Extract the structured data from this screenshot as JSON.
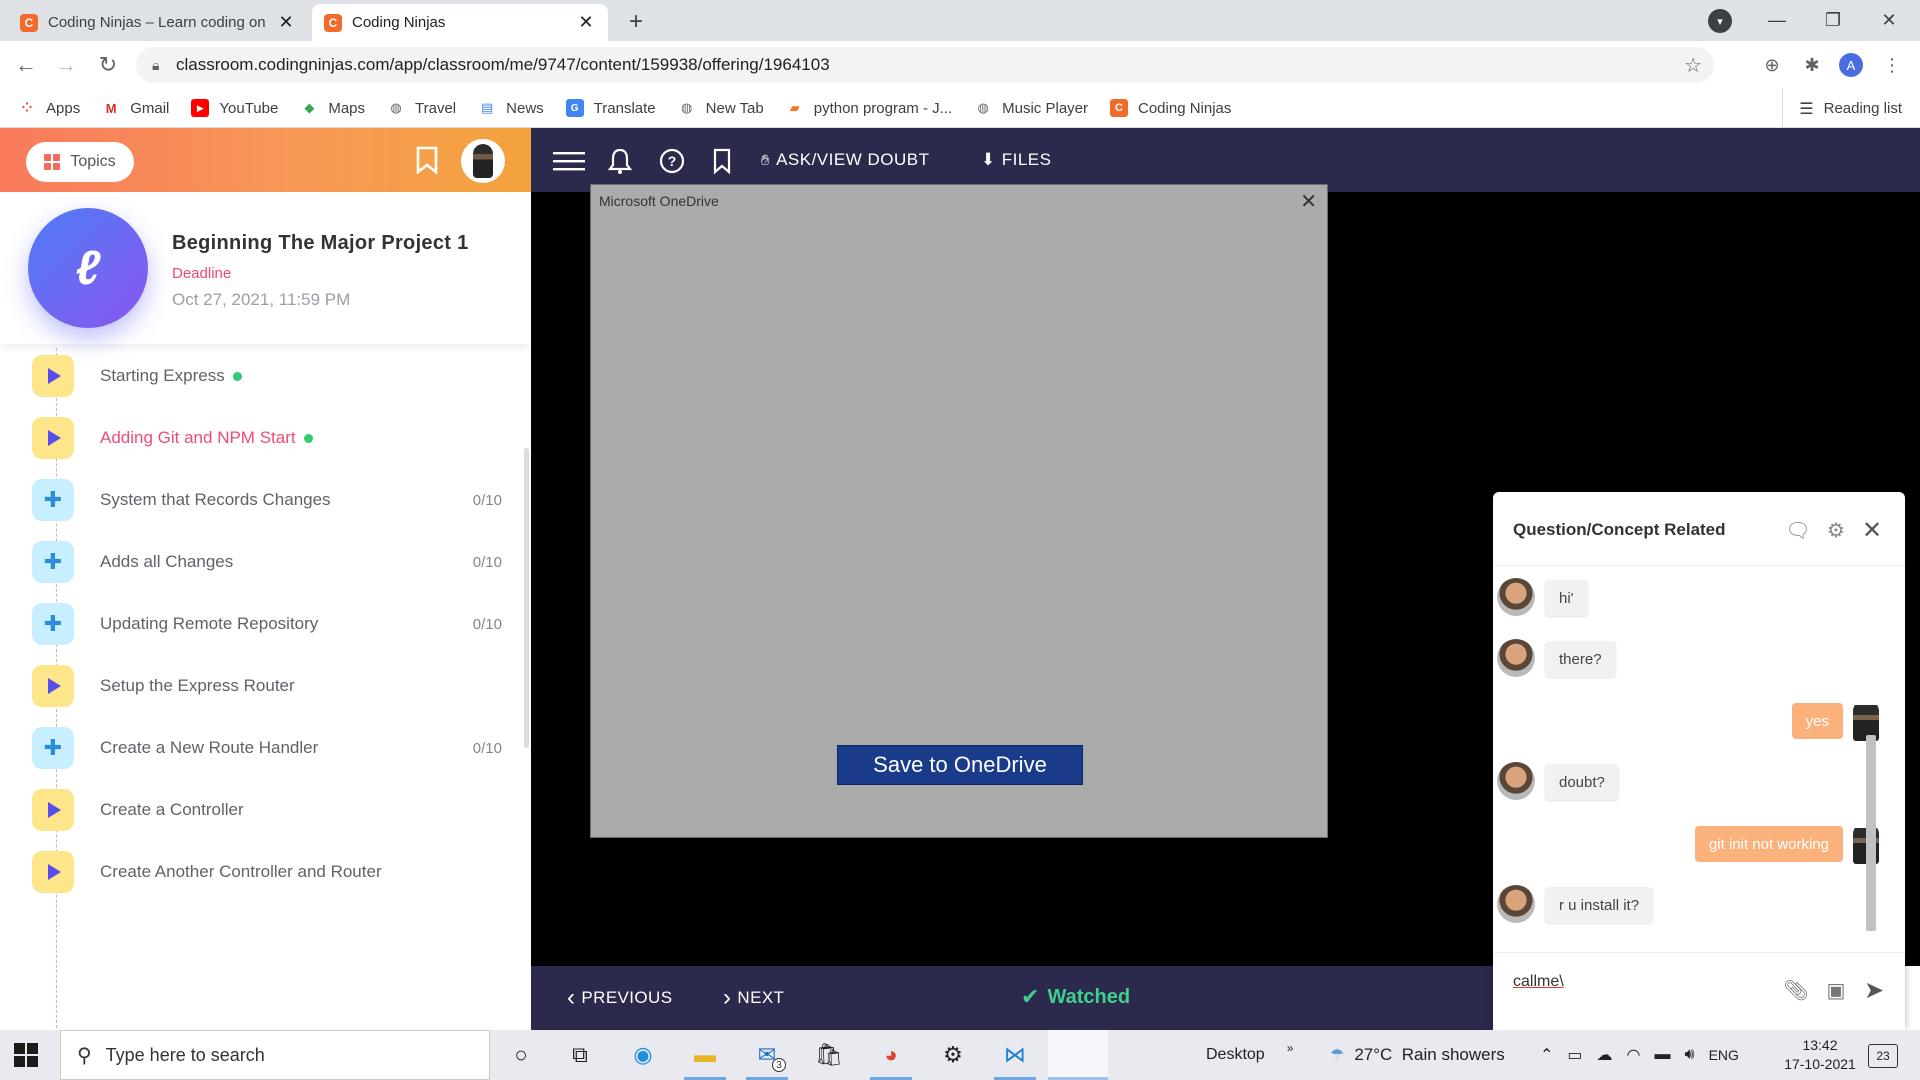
{
  "browser": {
    "tabs": [
      {
        "title": "Coding Ninjas – Learn coding on",
        "active": false
      },
      {
        "title": "Coding Ninjas",
        "active": true
      }
    ],
    "url": "classroom.codingninjas.com/app/classroom/me/9747/content/159938/offering/1964103",
    "profile_initial": "A",
    "bookmarks": [
      {
        "label": "Apps",
        "icon": "apps-grid-icon"
      },
      {
        "label": "Gmail",
        "icon": "gmail-icon"
      },
      {
        "label": "YouTube",
        "icon": "youtube-icon"
      },
      {
        "label": "Maps",
        "icon": "maps-icon"
      },
      {
        "label": "Travel",
        "icon": "globe-icon"
      },
      {
        "label": "News",
        "icon": "news-icon"
      },
      {
        "label": "Translate",
        "icon": "translate-icon"
      },
      {
        "label": "New Tab",
        "icon": "globe-icon"
      },
      {
        "label": "python program - J...",
        "icon": "notebook-icon"
      },
      {
        "label": "Music Player",
        "icon": "globe-icon"
      },
      {
        "label": "Coding Ninjas",
        "icon": "coding-ninjas-icon"
      }
    ],
    "reading_list": "Reading list"
  },
  "left_panel": {
    "topics_label": "Topics",
    "course_title": "Beginning The Major Project 1",
    "deadline_label": "Deadline",
    "deadline_date": "Oct 27, 2021, 11:59 PM",
    "items": [
      {
        "label": "Starting Express",
        "type": "video",
        "done": true,
        "score": "",
        "active": false
      },
      {
        "label": "Adding Git and NPM Start",
        "type": "video",
        "done": true,
        "score": "",
        "active": true
      },
      {
        "label": "System that Records Changes",
        "type": "problem",
        "done": false,
        "score": "0/10",
        "active": false
      },
      {
        "label": "Adds all Changes",
        "type": "problem",
        "done": false,
        "score": "0/10",
        "active": false
      },
      {
        "label": "Updating Remote Repository",
        "type": "problem",
        "done": false,
        "score": "0/10",
        "active": false
      },
      {
        "label": "Setup the Express Router",
        "type": "video",
        "done": false,
        "score": "",
        "active": false
      },
      {
        "label": "Create a New Route Handler",
        "type": "problem",
        "done": false,
        "score": "0/10",
        "active": false
      },
      {
        "label": "Create a Controller",
        "type": "video",
        "done": false,
        "score": "",
        "active": false
      },
      {
        "label": "Create Another Controller and Router",
        "type": "video",
        "done": false,
        "score": "",
        "active": false
      }
    ]
  },
  "topnav": {
    "ask_doubt": "ASK/VIEW DOUBT",
    "files": "FILES"
  },
  "onedrive": {
    "title": "Microsoft OneDrive",
    "button": "Save to OneDrive"
  },
  "bottombar": {
    "previous": "PREVIOUS",
    "next": "NEXT",
    "watched": "Watched"
  },
  "chat": {
    "title": "Question/Concept Related",
    "messages": [
      {
        "from": "them",
        "text": "hi'"
      },
      {
        "from": "them",
        "text": "there?"
      },
      {
        "from": "me",
        "text": "yes"
      },
      {
        "from": "them",
        "text": "doubt?"
      },
      {
        "from": "me",
        "text": "git init not working"
      },
      {
        "from": "them",
        "text": "r u install it?"
      }
    ],
    "input_value": "callme\\"
  },
  "taskbar": {
    "search_placeholder": "Type here to search",
    "mail_badge": "3",
    "desktop_label": "Desktop",
    "weather": "27°C  Rain showers",
    "language": "ENG",
    "time": "13:42",
    "date": "17-10-2021",
    "notification_count": "23"
  }
}
